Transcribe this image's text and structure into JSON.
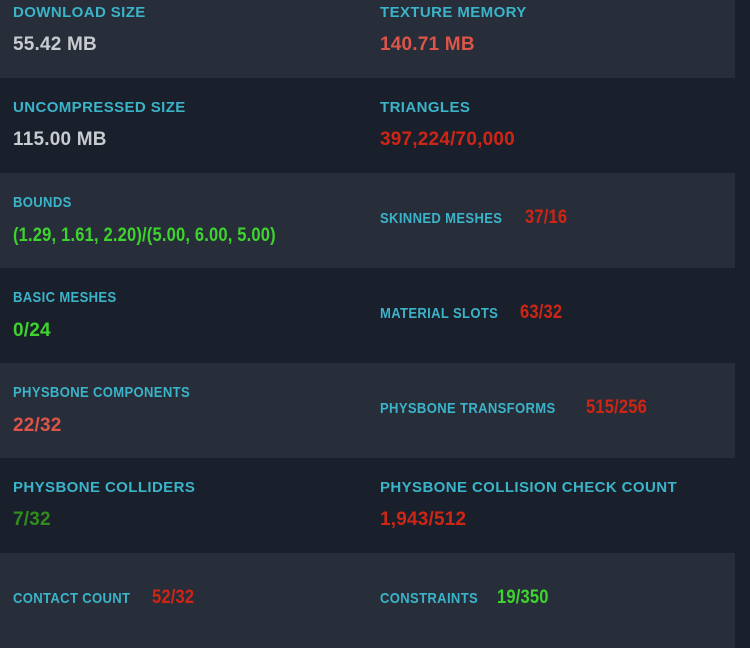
{
  "panel": {
    "bg_color": "#1a202b",
    "row_highlight_color": "#272d39",
    "label_color": "#3bb3c9",
    "value_colors": {
      "gray": "#c8cbd0",
      "salmon": "#dd5448",
      "red": "#ce2515",
      "green": "#3ed32e",
      "dark_green": "#2f8c1d"
    },
    "rows": [
      {
        "cells": [
          {
            "label": "DOWNLOAD SIZE",
            "value": "55.42 MB",
            "tone": "gray",
            "label_condensed": false,
            "value_condensed": false
          },
          {
            "label": "TEXTURE MEMORY",
            "value": "140.71 MB",
            "tone": "salmon",
            "label_condensed": false,
            "value_condensed": false
          }
        ]
      },
      {
        "cells": [
          {
            "label": "UNCOMPRESSED SIZE",
            "value": "115.00 MB",
            "tone": "gray",
            "label_condensed": false,
            "value_condensed": false
          },
          {
            "label": "TRIANGLES",
            "value": "397,224/70,000",
            "tone": "red",
            "label_condensed": false,
            "value_condensed": false
          }
        ]
      },
      {
        "cells": [
          {
            "label": "BOUNDS",
            "value": "(1.29, 1.61, 2.20)/(5.00, 6.00, 5.00)",
            "tone": "green",
            "label_condensed": true,
            "value_condensed": true
          },
          {
            "label": "SKINNED MESHES",
            "value": "37/16",
            "tone": "red",
            "label_condensed": true,
            "value_condensed": true
          }
        ]
      },
      {
        "cells": [
          {
            "label": "BASIC MESHES",
            "value": "0/24",
            "tone": "green",
            "label_condensed": true,
            "value_condensed": false
          },
          {
            "label": "MATERIAL SLOTS",
            "value": "63/32",
            "tone": "red",
            "label_condensed": true,
            "value_condensed": true
          }
        ]
      },
      {
        "cells": [
          {
            "label": "PHYSBONE COMPONENTS",
            "value": "22/32",
            "tone": "salmon",
            "label_condensed": true,
            "value_condensed": false
          },
          {
            "label": "PHYSBONE TRANSFORMS",
            "value": "515/256",
            "tone": "red",
            "label_condensed": true,
            "value_condensed": true
          }
        ]
      },
      {
        "cells": [
          {
            "label": "PHYSBONE COLLIDERS",
            "value": "7/32",
            "tone": "dark_green",
            "label_condensed": false,
            "value_condensed": false
          },
          {
            "label": "PHYSBONE COLLISION CHECK COUNT",
            "value": "1,943/512",
            "tone": "red",
            "label_condensed": false,
            "value_condensed": false
          }
        ]
      },
      {
        "cells": [
          {
            "label": "CONTACT COUNT",
            "value": "52/32",
            "tone": "red",
            "label_condensed": true,
            "value_condensed": true
          },
          {
            "label": "CONSTRAINTS",
            "value": "19/350",
            "tone": "green",
            "label_condensed": true,
            "value_condensed": true
          }
        ]
      }
    ]
  }
}
